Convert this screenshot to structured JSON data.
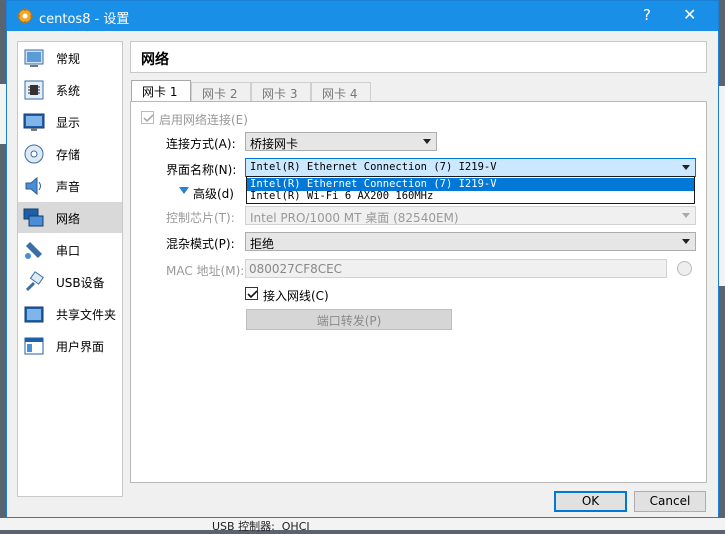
{
  "window": {
    "title": "centos8 - 设置",
    "help": "?",
    "close": "✕"
  },
  "sidebar": {
    "items": [
      {
        "label": "常规",
        "icon": "general-icon"
      },
      {
        "label": "系统",
        "icon": "system-chip-icon"
      },
      {
        "label": "显示",
        "icon": "display-monitor-icon"
      },
      {
        "label": "存储",
        "icon": "storage-disk-icon"
      },
      {
        "label": "声音",
        "icon": "speaker-icon"
      },
      {
        "label": "网络",
        "icon": "network-icon",
        "active": true
      },
      {
        "label": "串口",
        "icon": "serial-port-icon"
      },
      {
        "label": "USB设备",
        "icon": "usb-icon"
      },
      {
        "label": "共享文件夹",
        "icon": "shared-folder-icon"
      },
      {
        "label": "用户界面",
        "icon": "user-interface-icon"
      }
    ]
  },
  "page": {
    "title": "网络"
  },
  "tabs": [
    {
      "label": "网卡 1",
      "active": true
    },
    {
      "label": "网卡 2"
    },
    {
      "label": "网卡 3"
    },
    {
      "label": "网卡 4"
    }
  ],
  "form": {
    "enable_label": "启用网络连接(E)",
    "enable_checked": true,
    "attach_label": "连接方式(A):",
    "attach_value": "桥接网卡",
    "name_label": "界面名称(N):",
    "name_value": "Intel(R) Ethernet Connection (7) I219-V",
    "name_options": [
      "Intel(R) Ethernet Connection (7) I219-V",
      "Intel(R) Wi-Fi 6 AX200 160MHz"
    ],
    "advanced_label": "高级(d)",
    "adapter_label": "控制芯片(T):",
    "adapter_value": "Intel PRO/1000 MT 桌面 (82540EM)",
    "promisc_label": "混杂模式(P):",
    "promisc_value": "拒绝",
    "mac_label": "MAC 地址(M):",
    "mac_value": "080027CF8CEC",
    "cable_label": "接入网线(C)",
    "cable_checked": true,
    "port_forward_label": "端口转发(P)"
  },
  "buttons": {
    "ok": "OK",
    "cancel": "Cancel"
  },
  "background": {
    "bottom_text": "USB 控制器:  OHCI"
  },
  "colors": {
    "titlebar": "#1a8fe8",
    "selection": "#0078d7",
    "accent_triangle": "#2a7fd6"
  }
}
